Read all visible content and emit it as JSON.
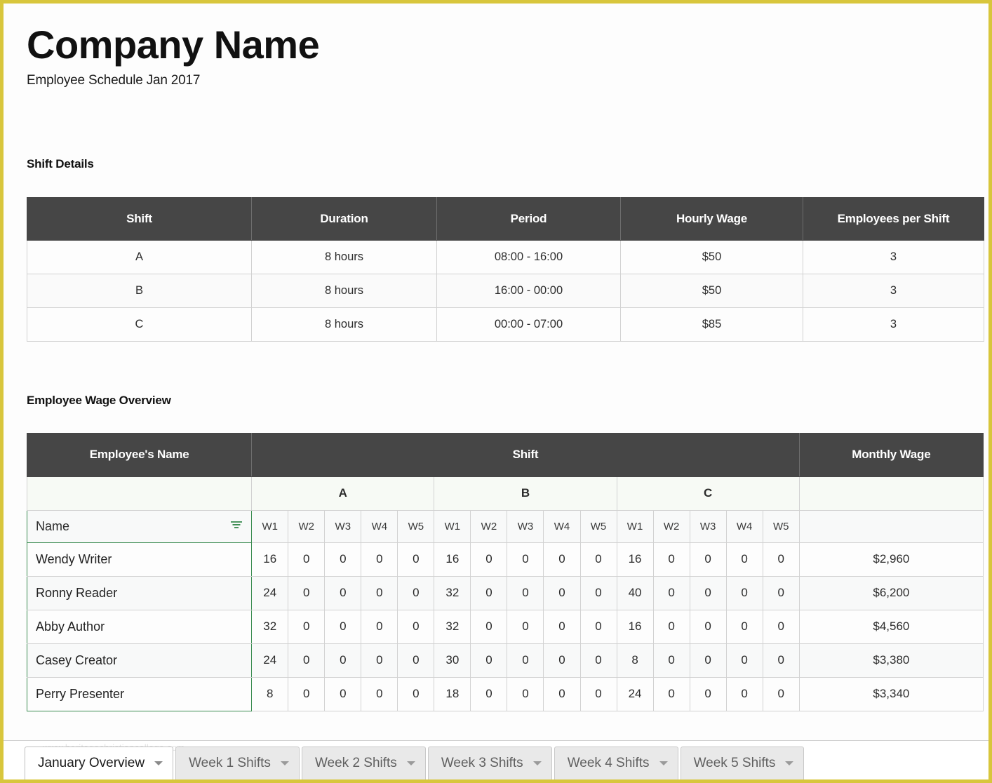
{
  "header": {
    "company_name": "Company Name",
    "subtitle": "Employee Schedule Jan 2017"
  },
  "watermark": "www.heritagechristiancollege.com",
  "shift_details": {
    "section_title": "Shift Details",
    "columns": [
      "Shift",
      "Duration",
      "Period",
      "Hourly Wage",
      "Employees per Shift"
    ],
    "rows": [
      {
        "shift": "A",
        "duration": "8 hours",
        "period": "08:00 - 16:00",
        "hourly_wage": "$50",
        "employees_per_shift": "3"
      },
      {
        "shift": "B",
        "duration": "8 hours",
        "period": "16:00 - 00:00",
        "hourly_wage": "$50",
        "employees_per_shift": "3"
      },
      {
        "shift": "C",
        "duration": "8 hours",
        "period": "00:00 - 07:00",
        "hourly_wage": "$85",
        "employees_per_shift": "3"
      }
    ]
  },
  "wage_overview": {
    "section_title": "Employee Wage Overview",
    "header_name": "Employee's Name",
    "header_shift": "Shift",
    "header_monthly_wage": "Monthly Wage",
    "shift_groups": [
      "A",
      "B",
      "C"
    ],
    "week_labels": [
      "W1",
      "W2",
      "W3",
      "W4",
      "W5"
    ],
    "filter_label": "Name",
    "filter_icon": "filter-icon",
    "rows": [
      {
        "name": "Wendy Writer",
        "A": [
          "16",
          "0",
          "0",
          "0",
          "0"
        ],
        "B": [
          "16",
          "0",
          "0",
          "0",
          "0"
        ],
        "C": [
          "16",
          "0",
          "0",
          "0",
          "0"
        ],
        "monthly_wage": "$2,960"
      },
      {
        "name": "Ronny Reader",
        "A": [
          "24",
          "0",
          "0",
          "0",
          "0"
        ],
        "B": [
          "32",
          "0",
          "0",
          "0",
          "0"
        ],
        "C": [
          "40",
          "0",
          "0",
          "0",
          "0"
        ],
        "monthly_wage": "$6,200"
      },
      {
        "name": "Abby Author",
        "A": [
          "32",
          "0",
          "0",
          "0",
          "0"
        ],
        "B": [
          "32",
          "0",
          "0",
          "0",
          "0"
        ],
        "C": [
          "16",
          "0",
          "0",
          "0",
          "0"
        ],
        "monthly_wage": "$4,560"
      },
      {
        "name": "Casey Creator",
        "A": [
          "24",
          "0",
          "0",
          "0",
          "0"
        ],
        "B": [
          "30",
          "0",
          "0",
          "0",
          "0"
        ],
        "C": [
          "8",
          "0",
          "0",
          "0",
          "0"
        ],
        "monthly_wage": "$3,380"
      },
      {
        "name": "Perry Presenter",
        "A": [
          "8",
          "0",
          "0",
          "0",
          "0"
        ],
        "B": [
          "18",
          "0",
          "0",
          "0",
          "0"
        ],
        "C": [
          "24",
          "0",
          "0",
          "0",
          "0"
        ],
        "monthly_wage": "$3,340"
      }
    ]
  },
  "sheet_tabs": [
    {
      "label": "January Overview",
      "active": true
    },
    {
      "label": "Week 1 Shifts",
      "active": false
    },
    {
      "label": "Week 2 Shifts",
      "active": false
    },
    {
      "label": "Week 3 Shifts",
      "active": false
    },
    {
      "label": "Week 4 Shifts",
      "active": false
    },
    {
      "label": "Week 5 Shifts",
      "active": false
    }
  ],
  "colors": {
    "frame_border": "#d8c63c",
    "table_header": "#464646",
    "selection_green": "#3c8d52",
    "group_row_bg": "#f7faf5"
  }
}
